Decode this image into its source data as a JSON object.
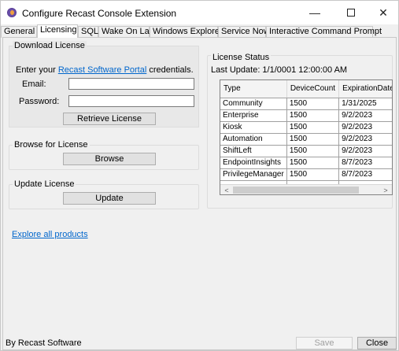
{
  "window": {
    "title": "Configure Recast Console Extension",
    "minimize_glyph": "—",
    "close_glyph": "✕"
  },
  "tabs": [
    {
      "label": "General"
    },
    {
      "label": "Licensing"
    },
    {
      "label": "SQL"
    },
    {
      "label": "Wake On Lan"
    },
    {
      "label": "Windows Explorer"
    },
    {
      "label": "Service Now"
    },
    {
      "label": "Interactive Command Prompt"
    }
  ],
  "download": {
    "title": "Download License",
    "intro_prefix": "Enter your ",
    "intro_link": "Recast Software Portal",
    "intro_suffix": " credentials.",
    "email_label": "Email:",
    "email_value": "",
    "password_label": "Password:",
    "password_value": "",
    "retrieve_button": "Retrieve License"
  },
  "browse": {
    "title": "Browse for License",
    "button": "Browse"
  },
  "update": {
    "title": "Update License",
    "button": "Update"
  },
  "explore_link": "Explore all products",
  "status": {
    "title": "License Status",
    "last_update": "Last Update:  1/1/0001 12:00:00 AM",
    "columns": [
      "Type",
      "DeviceCount",
      "ExpirationDate"
    ],
    "rows": [
      [
        "Community",
        "1500",
        "1/31/2025"
      ],
      [
        "Enterprise",
        "1500",
        "9/2/2023"
      ],
      [
        "Kiosk",
        "1500",
        "9/2/2023"
      ],
      [
        "Automation",
        "1500",
        "9/2/2023"
      ],
      [
        "ShiftLeft",
        "1500",
        "9/2/2023"
      ],
      [
        "EndpointInsights",
        "1500",
        "8/7/2023"
      ],
      [
        "PrivilegeManager",
        "1500",
        "8/7/2023"
      ]
    ],
    "scroll_left_glyph": "<",
    "scroll_right_glyph": ">"
  },
  "footer": {
    "brand": "By Recast Software",
    "save_button": "Save",
    "close_button": "Close"
  }
}
